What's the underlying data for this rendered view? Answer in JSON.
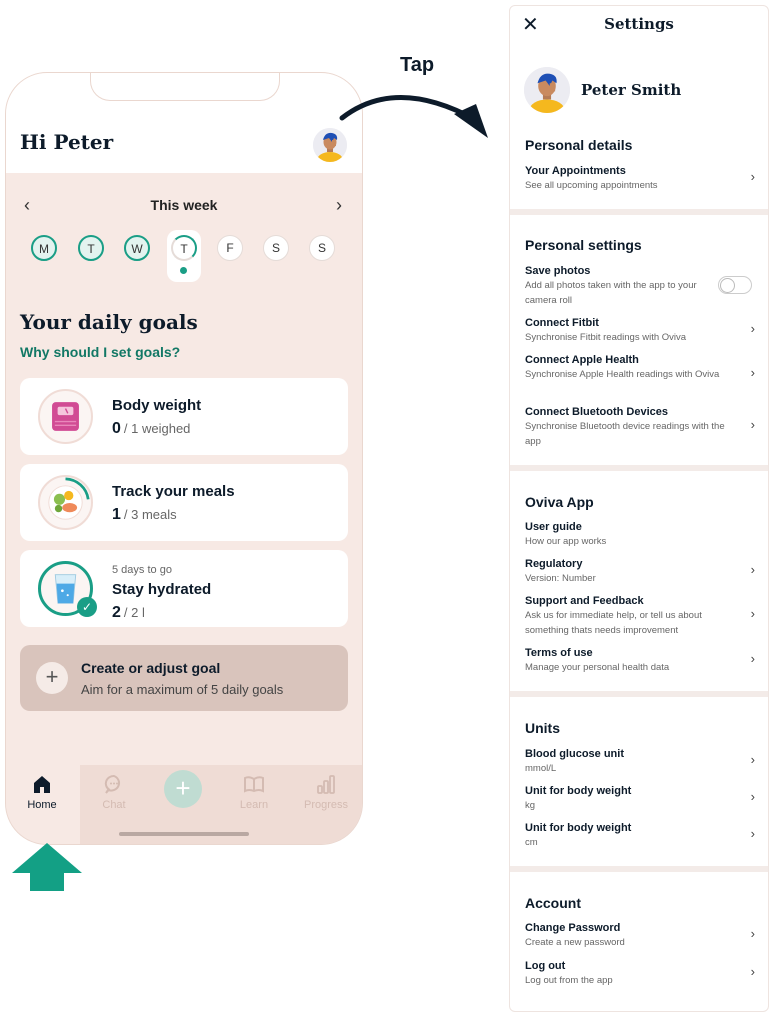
{
  "annotation": {
    "tap_label": "Tap"
  },
  "phone": {
    "greeting": "Hi Peter",
    "week": {
      "title": "This week",
      "prev_icon": "chevron-left",
      "next_icon": "chevron-right"
    },
    "days": [
      {
        "label": "M",
        "state": "done"
      },
      {
        "label": "T",
        "state": "done"
      },
      {
        "label": "W",
        "state": "done"
      },
      {
        "label": "T",
        "state": "today"
      },
      {
        "label": "F",
        "state": "future"
      },
      {
        "label": "S",
        "state": "future"
      },
      {
        "label": "S",
        "state": "future"
      }
    ],
    "goals_title": "Your daily goals",
    "goals_link": "Why should I set goals?",
    "goals": [
      {
        "name": "Body weight",
        "count": "0",
        "target": "/ 1 weighed",
        "icon": "scale-icon"
      },
      {
        "name": "Track your meals",
        "count": "1",
        "target": "/ 3 meals",
        "icon": "meal-plate-icon",
        "progress": 0.33
      },
      {
        "name": "Stay hydrated",
        "count": "2",
        "target": "/ 2 l",
        "subtitle": "5 days to go",
        "icon": "water-glass-icon",
        "progress": 1.0
      }
    ],
    "create_goal": {
      "title": "Create or adjust goal",
      "subtitle": "Aim for a maximum of 5 daily goals"
    },
    "tabs": [
      {
        "label": "Home",
        "icon": "home-icon",
        "active": true
      },
      {
        "label": "Chat",
        "icon": "chat-icon",
        "active": false
      },
      {
        "label": "",
        "icon": "plus-icon",
        "active": false
      },
      {
        "label": "Learn",
        "icon": "book-icon",
        "active": false
      },
      {
        "label": "Progress",
        "icon": "bar-chart-icon",
        "active": false
      }
    ],
    "colors": {
      "accent": "#1a9e86",
      "background": "#f7e9e4",
      "arrow": "#13a085"
    }
  },
  "settings": {
    "title": "Settings",
    "close_icon": "close-icon",
    "user_name": "Peter Smith",
    "sections": [
      {
        "title": "Personal details",
        "items": [
          {
            "label": "Your Appointments",
            "desc": "See all upcoming appointments"
          }
        ]
      },
      {
        "title": "Personal settings",
        "items": [
          {
            "label": "Save photos",
            "desc": "Add all photos taken with the app to your camera roll",
            "toggle": false
          },
          {
            "label": "Connect Fitbit",
            "desc": "Synchronise Fitbit readings with Oviva"
          },
          {
            "label": "Connect Apple Health",
            "desc": "Synchronise Apple Health readings with Oviva"
          },
          {
            "label": "Connect Bluetooth Devices",
            "desc": "Synchronise Bluetooth device readings with the app"
          }
        ]
      },
      {
        "title": "Oviva App",
        "items": [
          {
            "label": "User guide",
            "desc": "How our app works"
          },
          {
            "label": "Regulatory",
            "desc": "Version: Number"
          },
          {
            "label": "Support and Feedback",
            "desc": "Ask us for immediate help, or tell us about something thats needs improvement"
          },
          {
            "label": "Terms of use",
            "desc": "Manage your personal health data"
          }
        ]
      },
      {
        "title": "Units",
        "items": [
          {
            "label": "Blood glucose unit",
            "desc": "mmol/L"
          },
          {
            "label": "Unit for body weight",
            "desc": "kg"
          },
          {
            "label": "Unit for body weight",
            "desc": "cm"
          }
        ]
      },
      {
        "title": "Account",
        "items": [
          {
            "label": "Change Password",
            "desc": "Create a new password"
          },
          {
            "label": "Log out",
            "desc": "Log out from the app"
          }
        ]
      }
    ]
  }
}
